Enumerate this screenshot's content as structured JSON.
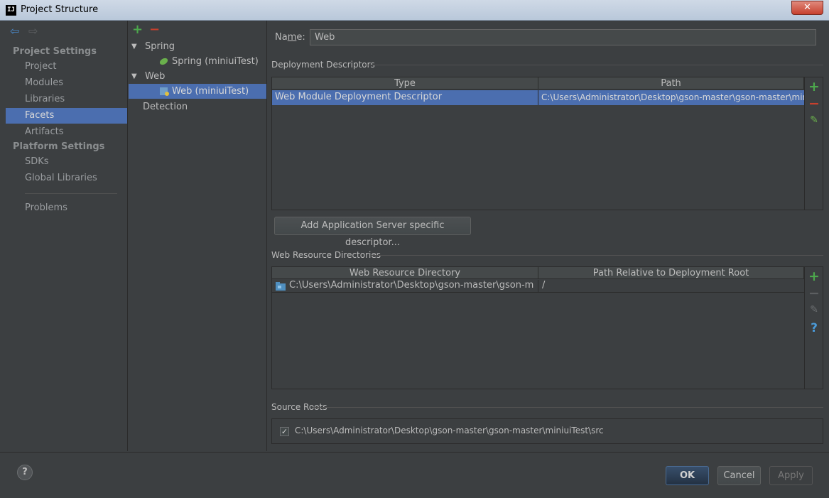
{
  "window": {
    "title": "Project Structure",
    "app_icon_text": "IJ",
    "close_glyph": "✕"
  },
  "nav": {
    "back_glyph": "⇦",
    "forward_glyph": "⇨",
    "sections": [
      {
        "title": "Project Settings",
        "items": [
          "Project",
          "Modules",
          "Libraries",
          "Facets",
          "Artifacts"
        ]
      },
      {
        "title": "Platform Settings",
        "items": [
          "SDKs",
          "Global Libraries"
        ]
      }
    ],
    "selected": "Facets",
    "problems_label": "Problems"
  },
  "tree": {
    "add_glyph": "+",
    "remove_glyph": "−",
    "nodes": [
      {
        "label": "Spring",
        "type": "group"
      },
      {
        "label": "Spring (miniuiTest)",
        "type": "spring-facet"
      },
      {
        "label": "Web",
        "type": "group"
      },
      {
        "label": "Web (miniuiTest)",
        "type": "web-facet",
        "selected": true
      },
      {
        "label": "Detection",
        "type": "plain"
      }
    ]
  },
  "form": {
    "name_label_prefix": "Na",
    "name_label_mnemonic": "m",
    "name_label_suffix": "e:",
    "name_value": "Web"
  },
  "deployment": {
    "section_title": "Deployment Descriptors",
    "columns": [
      "Type",
      "Path"
    ],
    "rows": [
      {
        "type": "Web Module Deployment Descriptor",
        "path": "C:\\Users\\Administrator\\Desktop\\gson-master\\gson-master\\mini"
      }
    ],
    "add_server_button": "Add Application Server specific descriptor..."
  },
  "web_resources": {
    "section_title": "Web Resource Directories",
    "columns": [
      "Web Resource Directory",
      "Path Relative to Deployment Root"
    ],
    "rows": [
      {
        "directory": "C:\\Users\\Administrator\\Desktop\\gson-master\\gson-mast...",
        "relative": "/"
      }
    ]
  },
  "source_roots": {
    "section_title": "Source Roots",
    "items": [
      {
        "checked": true,
        "path": "C:\\Users\\Administrator\\Desktop\\gson-master\\gson-master\\miniuiTest\\src"
      }
    ]
  },
  "toolbar_glyphs": {
    "add": "+",
    "remove": "−",
    "edit": "✎",
    "help": "?"
  },
  "footer": {
    "help_glyph": "?",
    "ok_label": "OK",
    "cancel_label": "Cancel",
    "apply_label": "Apply"
  },
  "colors": {
    "accent_green": "#4ca84c",
    "remove_red": "#c7402d",
    "selection_blue": "#4b6eaf",
    "background": "#3c3f41"
  }
}
